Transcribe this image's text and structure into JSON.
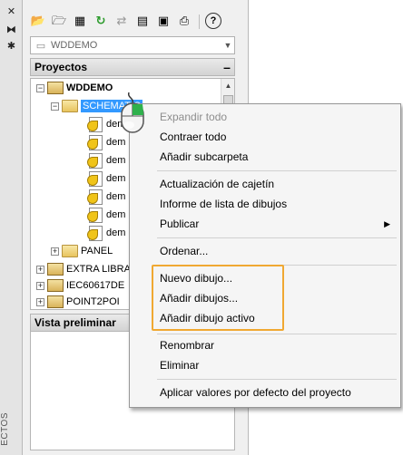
{
  "strip": {
    "buttons": [
      {
        "icon": "close-icon",
        "glyph": "✕"
      },
      {
        "icon": "autohide-icon",
        "glyph": "⧓"
      },
      {
        "icon": "properties-icon",
        "glyph": "✱"
      }
    ],
    "title": "ECTOS"
  },
  "toolbar": {
    "buttons": [
      {
        "icon": "open-project-icon",
        "glyph": "📂"
      },
      {
        "icon": "new-project-icon",
        "glyph": "🗁"
      },
      {
        "icon": "project-properties-icon",
        "glyph": "▦"
      },
      {
        "icon": "refresh-icon",
        "glyph": "↻"
      },
      {
        "icon": "update-icon",
        "glyph": "⇄"
      },
      {
        "icon": "batch-icon",
        "glyph": "▤"
      },
      {
        "icon": "reports-icon",
        "glyph": "▣"
      },
      {
        "icon": "plot-icon",
        "glyph": "⎙"
      },
      {
        "icon": "help-icon",
        "glyph": "?"
      }
    ]
  },
  "project_select": {
    "value": "WDDEMO"
  },
  "projects_panel": {
    "title": "Proyectos",
    "collapse": "–"
  },
  "tree": {
    "project": "WDDEMO",
    "folder_selected": "SCHEMATIC",
    "drawings": [
      "dem",
      "dem",
      "dem",
      "dem",
      "dem",
      "dem",
      "dem"
    ],
    "panel_folder": "PANEL",
    "other_projects": [
      "EXTRA LIBRA",
      "IEC60617DE",
      "POINT2POI"
    ]
  },
  "preview_panel": {
    "title": "Vista preliminar"
  },
  "menu": {
    "expand_all": "Expandir todo",
    "collapse_all": "Contraer todo",
    "add_subfolder": "Añadir subcarpeta",
    "update_titleblock": "Actualización de cajetín",
    "drawing_list_report": "Informe de lista de dibujos",
    "publish": "Publicar",
    "sort": "Ordenar...",
    "new_drawing": "Nuevo dibujo...",
    "add_drawings": "Añadir dibujos...",
    "add_active_drawing": "Añadir dibujo activo",
    "rename": "Renombrar",
    "delete": "Eliminar",
    "apply_project_defaults": "Aplicar valores por defecto del proyecto"
  },
  "colors": {
    "selection": "#3399ff",
    "highlight_box": "#f0a832"
  }
}
